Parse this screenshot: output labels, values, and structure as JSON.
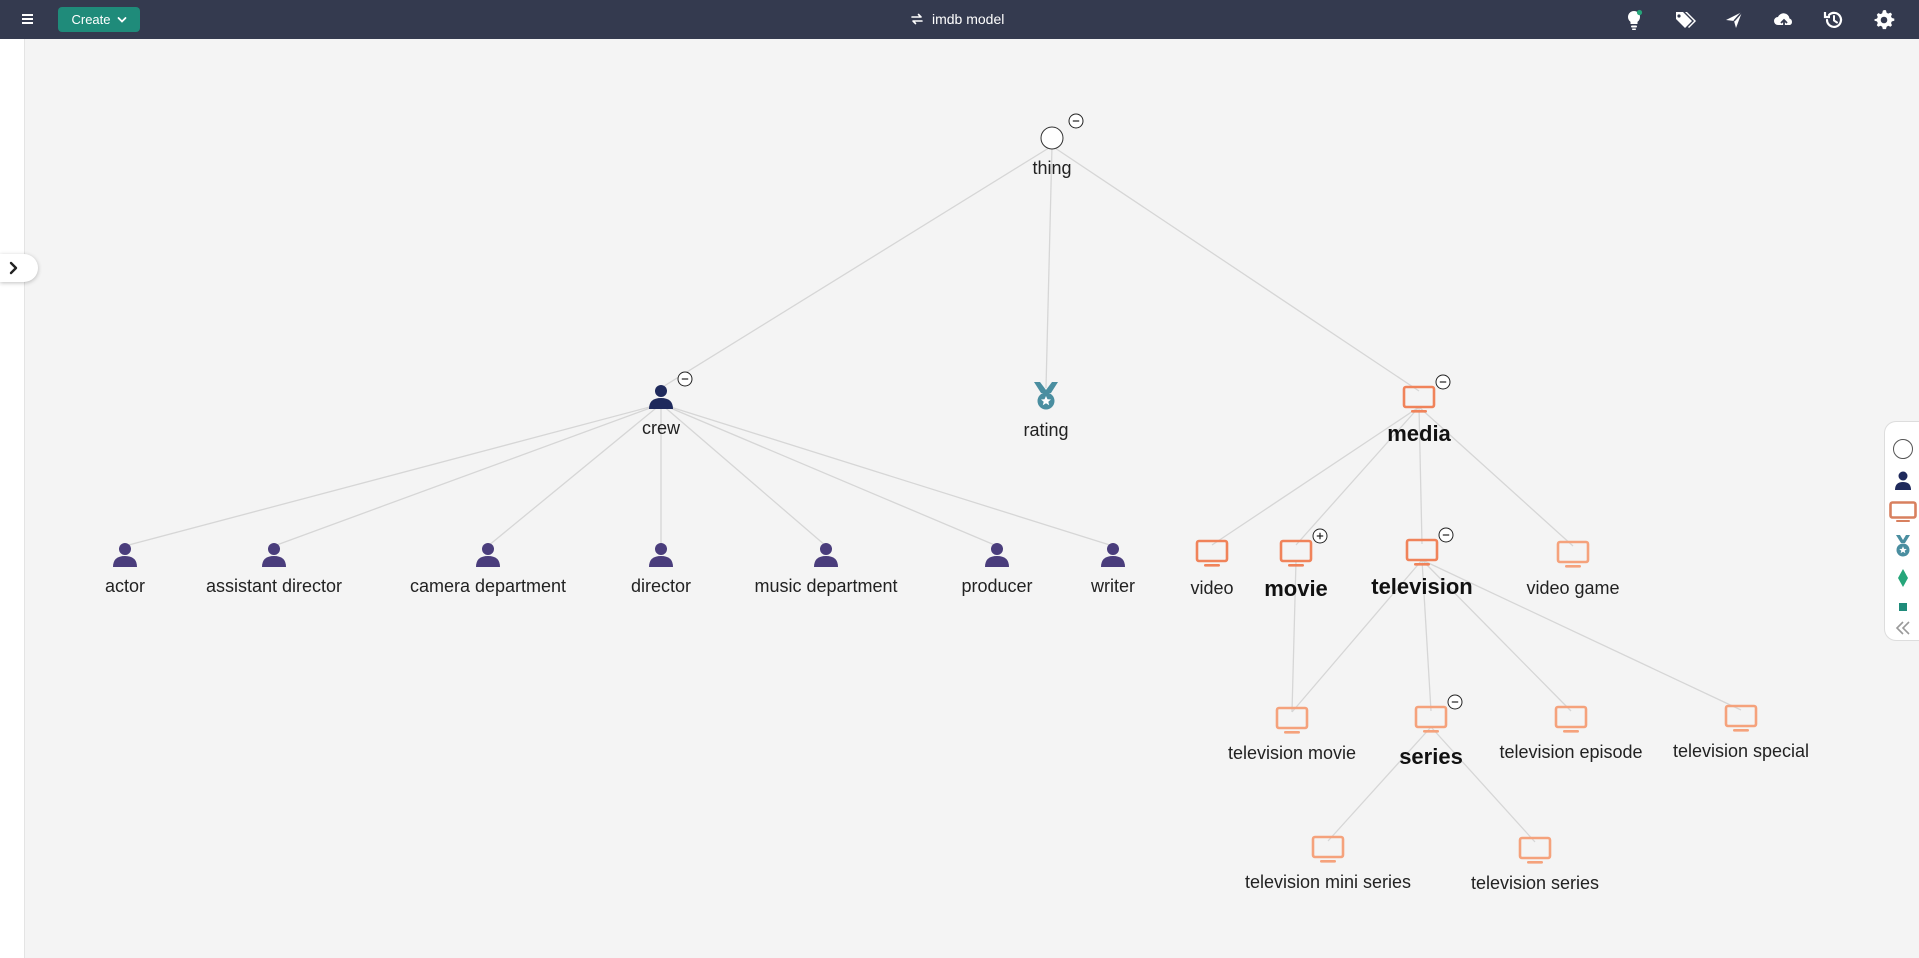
{
  "header": {
    "menu_icon": "hamburger-menu-icon",
    "create_label": "Create",
    "title": "imdb model",
    "icons": [
      "lightbulb-icon",
      "tags-icon",
      "share-graph-icon",
      "cloud-upload-icon",
      "history-icon",
      "settings-gear-icon"
    ]
  },
  "colors": {
    "topbar": "#343a4f",
    "create": "#1f8b7a",
    "crew": "#1f2a5c",
    "person": "#4a3d7c",
    "media": "#f0835a",
    "media_light": "#f5a27c",
    "rating": "#4a8ea0",
    "edge": "#d6d6d6",
    "legend_green": "#26a67a"
  },
  "graph": {
    "nodes": [
      {
        "id": "thing",
        "label": "thing",
        "icon": "circle-icon",
        "collapse": "-",
        "big": false
      },
      {
        "id": "crew",
        "label": "crew",
        "icon": "person-icon",
        "collapse": "-",
        "big": false
      },
      {
        "id": "rating",
        "label": "rating",
        "icon": "medal-icon",
        "collapse": "",
        "big": false
      },
      {
        "id": "media",
        "label": "media",
        "icon": "monitor-icon",
        "collapse": "-",
        "big": true
      },
      {
        "id": "actor",
        "label": "actor",
        "icon": "person-icon",
        "collapse": "",
        "big": false
      },
      {
        "id": "assistant_director",
        "label": "assistant director",
        "icon": "person-icon",
        "collapse": "",
        "big": false
      },
      {
        "id": "camera_department",
        "label": "camera department",
        "icon": "person-icon",
        "collapse": "",
        "big": false
      },
      {
        "id": "director",
        "label": "director",
        "icon": "person-icon",
        "collapse": "",
        "big": false
      },
      {
        "id": "music_department",
        "label": "music department",
        "icon": "person-icon",
        "collapse": "",
        "big": false
      },
      {
        "id": "producer",
        "label": "producer",
        "icon": "person-icon",
        "collapse": "",
        "big": false
      },
      {
        "id": "writer",
        "label": "writer",
        "icon": "person-icon",
        "collapse": "",
        "big": false
      },
      {
        "id": "video",
        "label": "video",
        "icon": "monitor-icon",
        "collapse": "",
        "big": false
      },
      {
        "id": "movie",
        "label": "movie",
        "icon": "monitor-icon",
        "collapse": "+",
        "big": true
      },
      {
        "id": "television",
        "label": "television",
        "icon": "monitor-icon",
        "collapse": "-",
        "big": true
      },
      {
        "id": "video_game",
        "label": "video game",
        "icon": "monitor-icon",
        "collapse": "",
        "big": false
      },
      {
        "id": "television_movie",
        "label": "television movie",
        "icon": "monitor-icon",
        "collapse": "",
        "big": false
      },
      {
        "id": "series",
        "label": "series",
        "icon": "monitor-icon",
        "collapse": "-",
        "big": true
      },
      {
        "id": "television_episode",
        "label": "television episode",
        "icon": "monitor-icon",
        "collapse": "",
        "big": false
      },
      {
        "id": "television_special",
        "label": "television special",
        "icon": "monitor-icon",
        "collapse": "",
        "big": false
      },
      {
        "id": "television_mini_series",
        "label": "television mini series",
        "icon": "monitor-icon",
        "collapse": "",
        "big": false
      },
      {
        "id": "television_series",
        "label": "television series",
        "icon": "monitor-icon",
        "collapse": "",
        "big": false
      }
    ],
    "edges": [
      [
        "thing",
        "crew"
      ],
      [
        "thing",
        "rating"
      ],
      [
        "thing",
        "media"
      ],
      [
        "crew",
        "actor"
      ],
      [
        "crew",
        "assistant_director"
      ],
      [
        "crew",
        "camera_department"
      ],
      [
        "crew",
        "director"
      ],
      [
        "crew",
        "music_department"
      ],
      [
        "crew",
        "producer"
      ],
      [
        "crew",
        "writer"
      ],
      [
        "media",
        "video"
      ],
      [
        "media",
        "movie"
      ],
      [
        "media",
        "television"
      ],
      [
        "media",
        "video_game"
      ],
      [
        "movie",
        "television_movie"
      ],
      [
        "television",
        "television_movie"
      ],
      [
        "television",
        "series"
      ],
      [
        "television",
        "television_episode"
      ],
      [
        "television",
        "television_special"
      ],
      [
        "series",
        "television_mini_series"
      ],
      [
        "series",
        "television_series"
      ]
    ]
  },
  "legend": {
    "items": [
      "circle-icon",
      "person-icon",
      "monitor-icon",
      "medal-icon",
      "diamond-icon",
      "square-icon",
      "double-chevron-left-icon"
    ]
  }
}
